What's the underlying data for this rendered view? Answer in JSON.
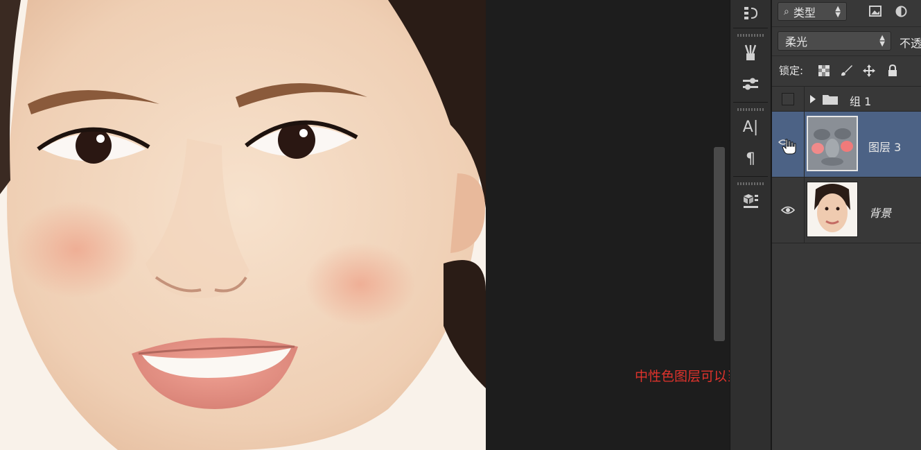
{
  "canvas": {
    "caption": "中性色图层可以当作特殊的蒙版"
  },
  "filter_bar": {
    "kind_label": "类型",
    "search_icon": "magnifier-icon",
    "icons": [
      "image-filter-icon",
      "adjustment-filter-icon"
    ]
  },
  "blend": {
    "mode": "柔光",
    "opacity_label": "不透"
  },
  "lock": {
    "label": "锁定:",
    "icons": [
      "lock-transparent-icon",
      "lock-paint-icon",
      "lock-move-icon",
      "lock-all-icon"
    ]
  },
  "layers": [
    {
      "name": "组 1",
      "type": "group",
      "visible": false,
      "expanded": false
    },
    {
      "name": "图层 3",
      "type": "pixel",
      "visible": true,
      "selected": true
    },
    {
      "name": "背景",
      "type": "background",
      "visible": true,
      "selected": false
    }
  ],
  "tools": [
    "history-icon",
    "brush-presets-icon",
    "tool-presets-icon",
    "character-icon",
    "paragraph-icon",
    "3d-icon"
  ],
  "colors": {
    "selected_row": "#4c6285",
    "panel_bg": "#383838",
    "caption": "#e0332c"
  }
}
